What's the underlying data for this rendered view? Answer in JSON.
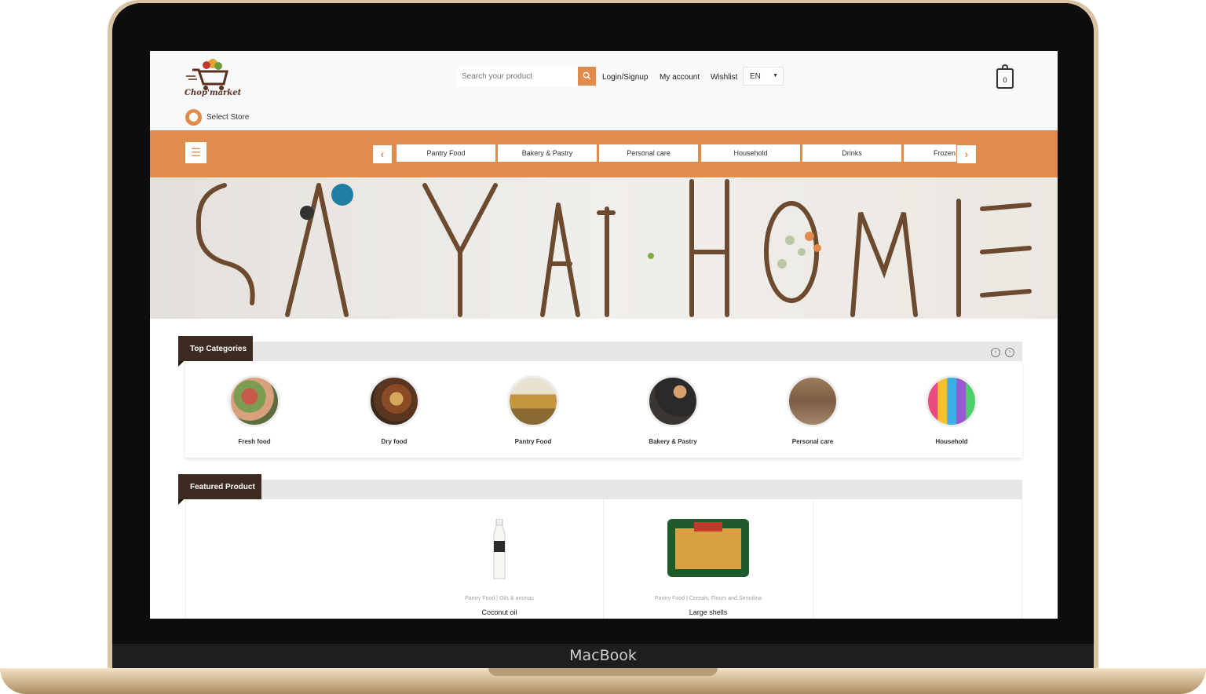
{
  "device": {
    "brand": "MacBook"
  },
  "header": {
    "logo_text": "Chop'market",
    "store_label": "Select Store",
    "search_placeholder": "Search your product",
    "nav": {
      "login": "Login/Signup",
      "account": "My account",
      "wishlist": "Wishlist"
    },
    "language": "EN",
    "cart_count": "0"
  },
  "category_bar": {
    "tabs": [
      "Pantry Food",
      "Bakery & Pastry",
      "Personal care",
      "Household",
      "Drinks",
      "Frozen"
    ]
  },
  "banner": {
    "text": "STAY AT HOME"
  },
  "top_categories": {
    "title": "Top Categories",
    "items": [
      {
        "name": "Fresh food"
      },
      {
        "name": "Dry food"
      },
      {
        "name": "Pantry Food"
      },
      {
        "name": "Bakery & Pastry"
      },
      {
        "name": "Personal care"
      },
      {
        "name": "Household"
      }
    ]
  },
  "featured": {
    "title": "Featured Product",
    "products": [
      {
        "category": "Pantry Food",
        "subcategory": "Oils & aromas",
        "name": "Coconut oil"
      },
      {
        "category": "Pantry Food",
        "subcategory": "Cereals, Flours and Semolina",
        "name": "Large shells"
      }
    ]
  },
  "colors": {
    "accent": "#df8c4c",
    "dark": "#3d2a20"
  }
}
